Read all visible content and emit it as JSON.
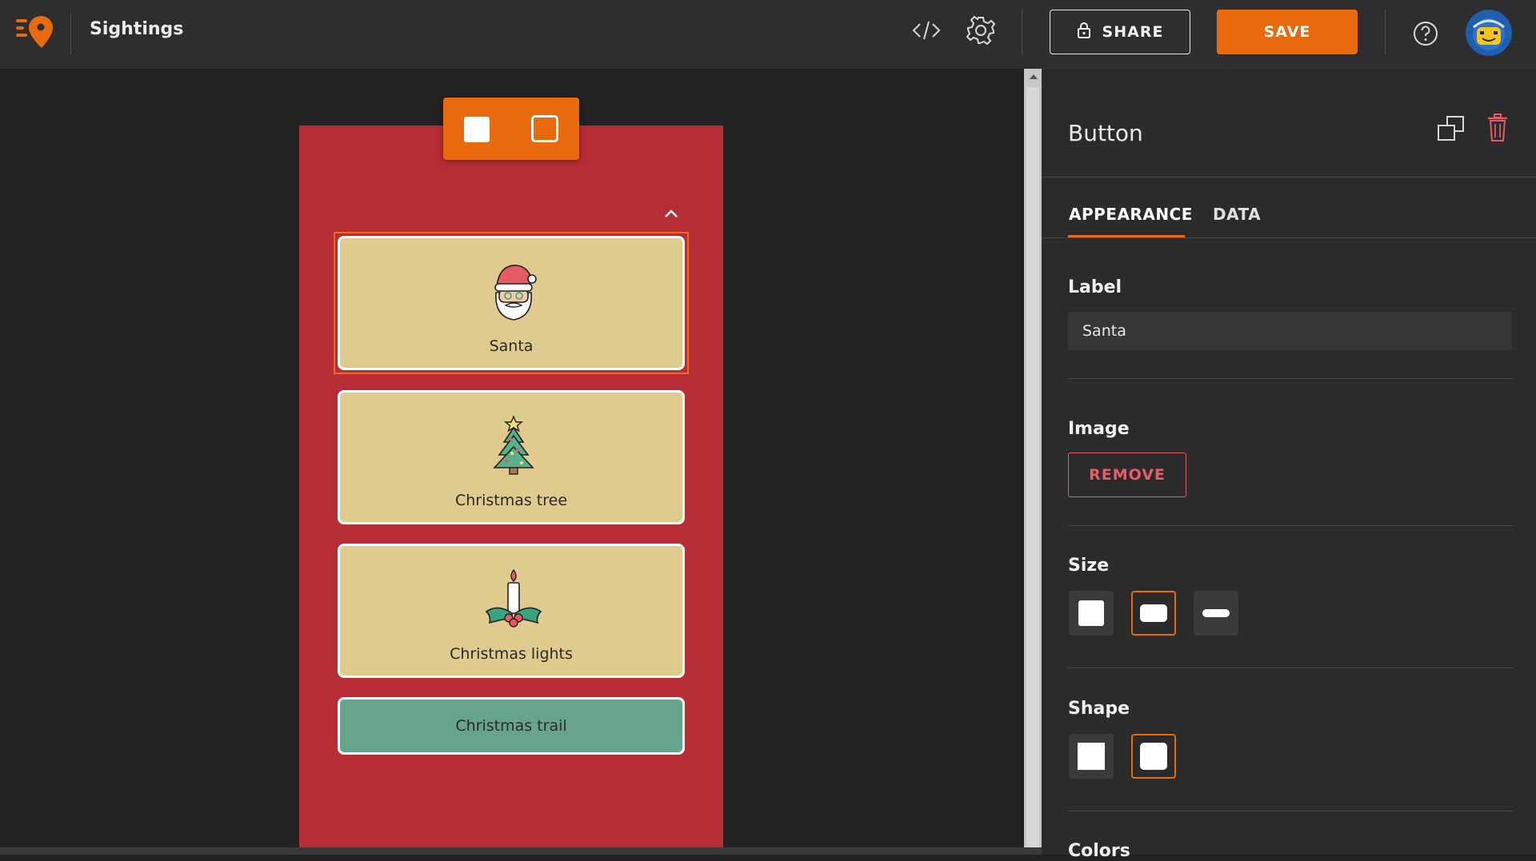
{
  "app": {
    "title": "Sightings"
  },
  "toolbar": {
    "share_label": "SHARE",
    "save_label": "SAVE"
  },
  "colors": {
    "accent": "#e86a0c",
    "canvas_bg": "#b82c35",
    "card_bg": "#dfcb8e",
    "trail_bg": "#66a58c",
    "danger": "#ea5c65"
  },
  "icons": [
    "logo-icon",
    "code-icon",
    "gear-icon",
    "lock-icon",
    "help-icon",
    "avatar",
    "square-icon",
    "frame-icon",
    "chevron-up-icon",
    "santa-icon",
    "christmas-tree-icon",
    "candle-icon",
    "duplicate-icon",
    "trash-icon"
  ],
  "buttons": [
    {
      "label": "Santa",
      "icon": "santa-icon",
      "selected": true
    },
    {
      "label": "Christmas tree",
      "icon": "christmas-tree-icon"
    },
    {
      "label": "Christmas lights",
      "icon": "candle-icon"
    }
  ],
  "trail_button": {
    "label": "Christmas trail"
  },
  "panel": {
    "title": "Button",
    "tabs": [
      {
        "label": "APPEARANCE",
        "active": true
      },
      {
        "label": "DATA",
        "active": false
      }
    ],
    "label_section": {
      "heading": "Label",
      "value": "Santa"
    },
    "image_section": {
      "heading": "Image",
      "remove_label": "REMOVE"
    },
    "size_section": {
      "heading": "Size",
      "options": [
        "square",
        "wide",
        "bar"
      ],
      "selected": "wide"
    },
    "shape_section": {
      "heading": "Shape",
      "options": [
        "square",
        "rounded"
      ],
      "selected": "rounded"
    },
    "colors_section": {
      "heading": "Colors"
    }
  }
}
